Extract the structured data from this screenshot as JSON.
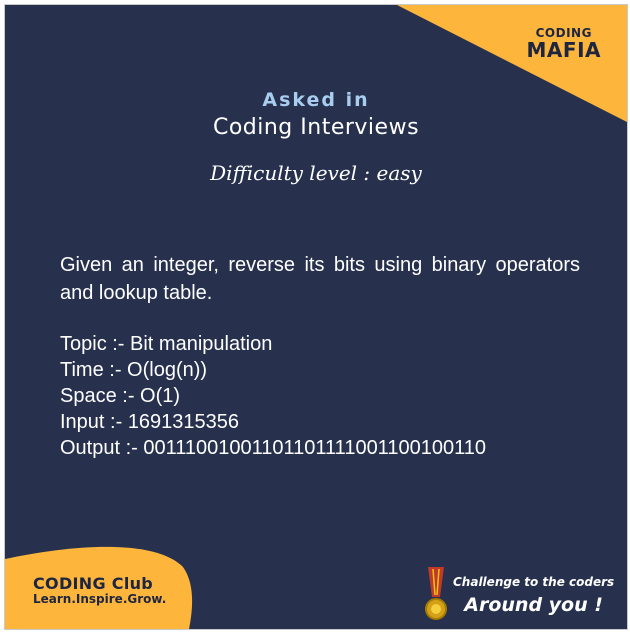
{
  "brand_top": {
    "line1": "CODING",
    "line2": "MAFIA"
  },
  "heading": {
    "asked": "Asked in",
    "subtitle": "Coding Interviews",
    "difficulty": "Difficulty level : easy"
  },
  "problem": "Given an integer, reverse its bits using binary operators and lookup table.",
  "details": {
    "topic": "Topic :- Bit manipulation",
    "time": "Time :- O(log(n))",
    "space": "Space :- O(1)",
    "input": "Input :-  1691315356",
    "output": "Output :- 00111001001101101111001100100110"
  },
  "brand_bottom": {
    "name": "CODING Club",
    "tagline": "Learn.Inspire.Grow."
  },
  "cta": {
    "line1": "Challenge to the coders",
    "line2": "Around you !"
  },
  "colors": {
    "background": "#27314d",
    "accent": "#fdb53c",
    "title_blue": "#a8cdef"
  }
}
